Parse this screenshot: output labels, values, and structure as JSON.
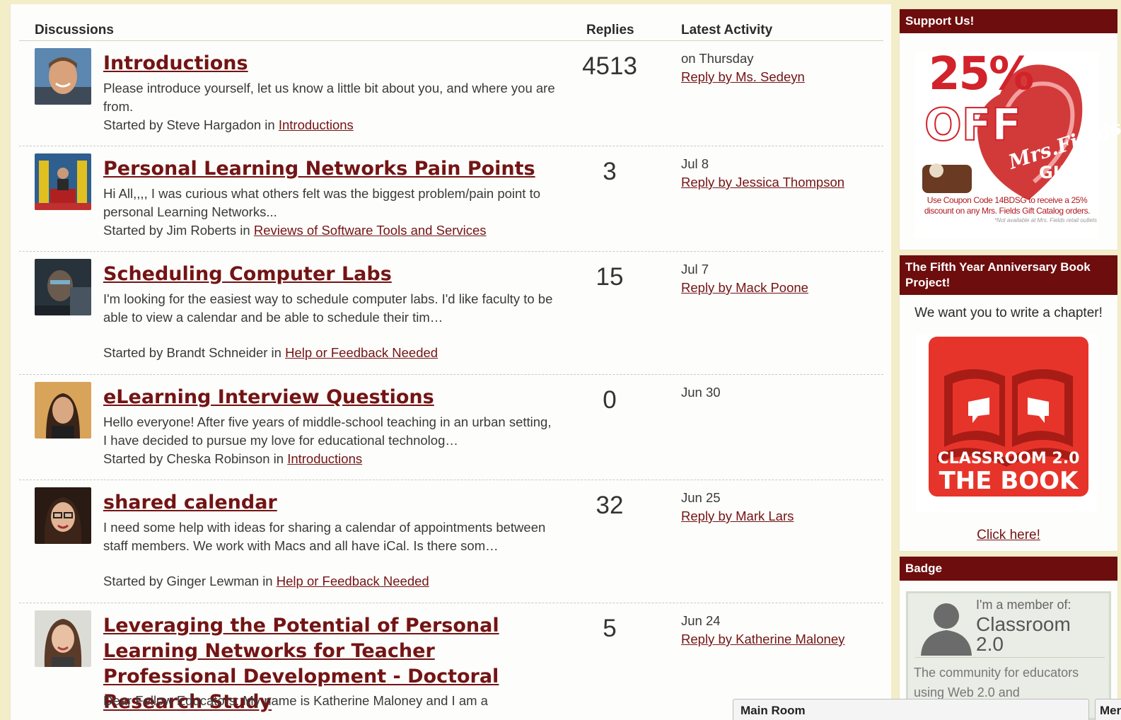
{
  "header": {
    "discussions": "Discussions",
    "replies": "Replies",
    "latest_activity": "Latest Activity"
  },
  "discussions": [
    {
      "title": "Introductions",
      "desc": "Please introduce yourself, let us know a little bit about you, and where you are from.",
      "started_prefix": "Started by Steve Hargadon in",
      "category": "Introductions",
      "replies": "4513",
      "date": "on Thursday",
      "reply_by": "Reply by Ms. Sedeyn"
    },
    {
      "title": "Personal Learning Networks Pain Points",
      "desc": "Hi All,,,,     I was curious what others felt was the biggest problem/pain point to personal Learning Networks...",
      "started_prefix": "Started by Jim Roberts in",
      "category": "Reviews of Software Tools and Services",
      "replies": "3",
      "date": "Jul 8",
      "reply_by": "Reply by Jessica Thompson"
    },
    {
      "title": "Scheduling Computer Labs",
      "desc": "I'm looking for the easiest way to schedule computer labs. I'd like faculty to be able to view a calendar and be able to schedule their tim…",
      "started_prefix": "Started by Brandt Schneider in",
      "category": "Help or Feedback Needed",
      "replies": "15",
      "date": "Jul 7",
      "reply_by": "Reply by Mack Poone"
    },
    {
      "title": "eLearning Interview Questions",
      "desc": "Hello everyone! After five years of middle-school teaching in an urban setting, I have decided to pursue my love for educational technolog…",
      "started_prefix": "Started by Cheska Robinson in",
      "category": "Introductions",
      "replies": "0",
      "date": "Jun 30",
      "reply_by": ""
    },
    {
      "title": "shared calendar",
      "desc": "I need some help with ideas for sharing a calendar of appointments between staff members. We work with Macs and all have iCal. Is there som…",
      "started_prefix": "Started by Ginger Lewman in",
      "category": "Help or Feedback Needed",
      "replies": "32",
      "date": "Jun 25",
      "reply_by": "Reply by Mark Lars"
    },
    {
      "title": "Leveraging the Potential of Personal Learning Networks for Teacher Professional Development - Doctoral Research Study",
      "desc": "Dear Fellow Educators:     My name is Katherine Maloney and I am a",
      "started_prefix": "",
      "category": "",
      "replies": "5",
      "date": "Jun 24",
      "reply_by": "Reply by Katherine Maloney"
    }
  ],
  "sidebar": {
    "support_title": "Support Us!",
    "promo": {
      "line1": "25%",
      "line2": "OFF",
      "brand": "Mrs.Fields",
      "gifts": "GIFTS",
      "coupon": "Use Coupon Code 14BDSG to receive a 25%",
      "coupon2": "discount on any Mrs. Fields Gift Catalog orders.",
      "fine": "*Not available at Mrs. Fields retail outlets"
    },
    "book_title": "The Fifth Year Anniversary Book Project!",
    "book_text": "We want you to write a chapter!",
    "book_img_line1": "CLASSROOM 2.0",
    "book_img_line2": "THE BOOK",
    "click_here": "Click here!",
    "badge_title": "Badge",
    "badge_member": "I'm a member of:",
    "badge_name": "Classroom 2.0",
    "badge_desc": "The community for educators using Web 2.0 and"
  },
  "chat": {
    "main_room": "Main Room",
    "members": "Mer"
  },
  "colors": {
    "accent": "#731414",
    "header_bg": "#6e0d0d",
    "page_bg": "#f3edc8"
  }
}
